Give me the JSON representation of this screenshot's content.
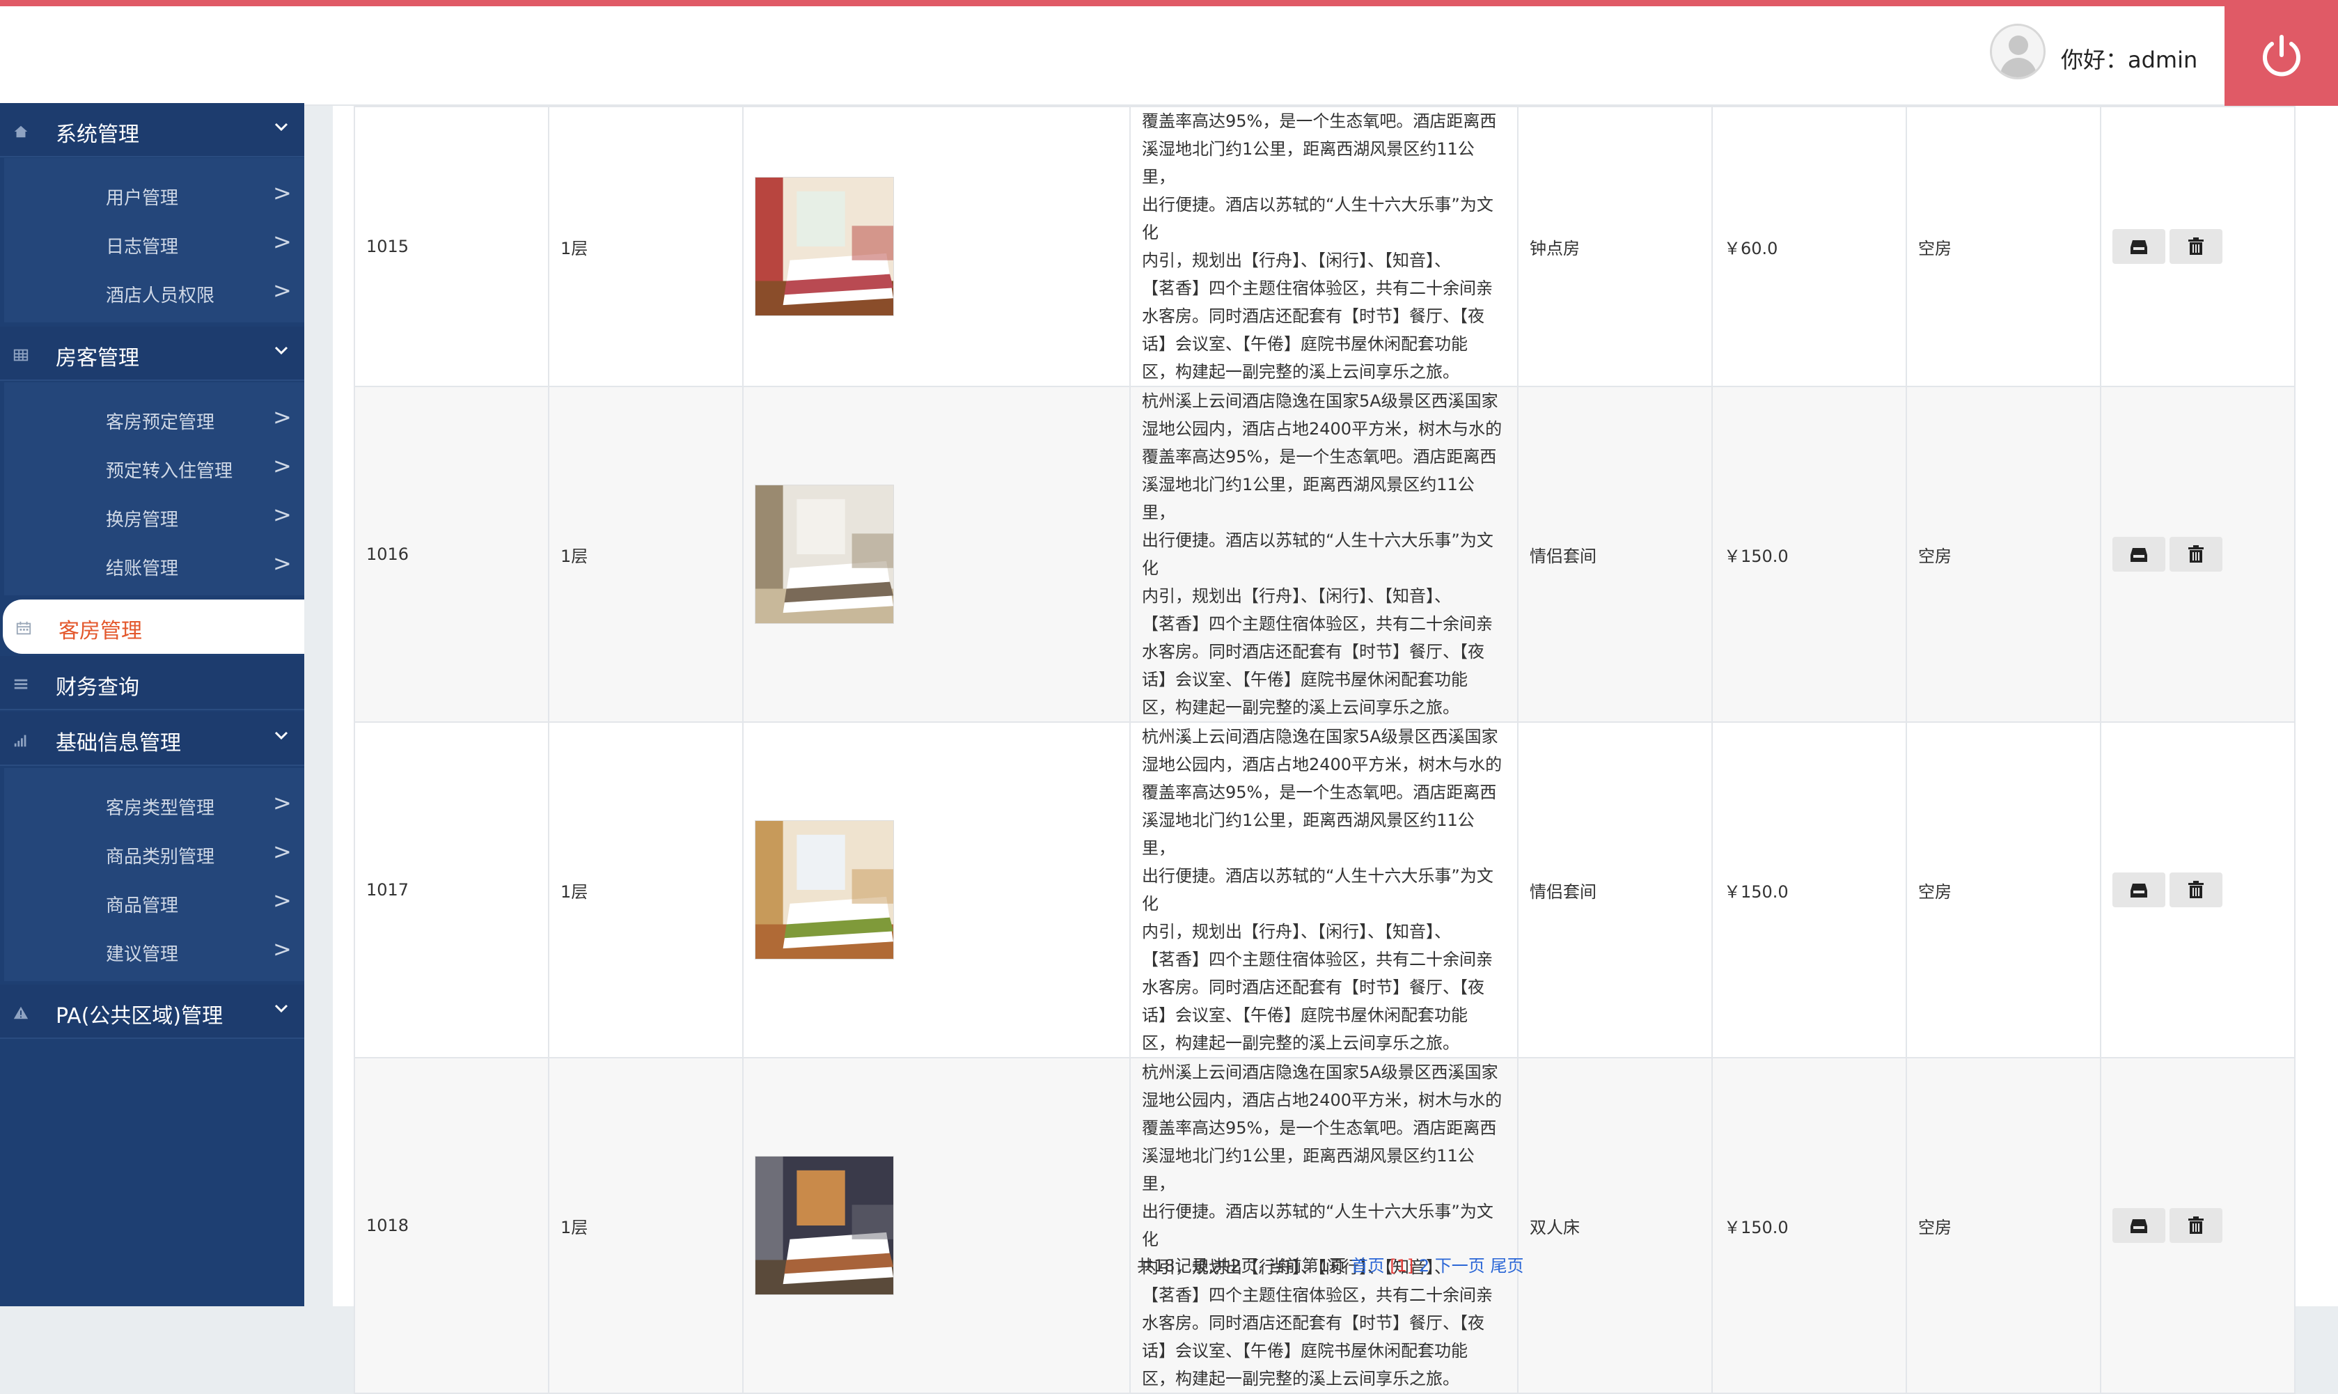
{
  "header": {
    "greeting": "你好：admin",
    "logout_icon": "power-icon"
  },
  "sidebar": {
    "groups": [
      {
        "label": "系统管理",
        "icon": "home-icon",
        "items": [
          "用户管理",
          "日志管理",
          "酒店人员权限"
        ]
      },
      {
        "label": "房客管理",
        "icon": "grid-icon",
        "items": [
          "客房预定管理",
          "预定转入住管理",
          "换房管理",
          "结账管理"
        ]
      },
      {
        "label": "客房管理",
        "icon": "calendar-icon",
        "active": true
      },
      {
        "label": "财务查询",
        "icon": "list-icon"
      },
      {
        "label": "基础信息管理",
        "icon": "signal-icon",
        "items": [
          "客房类型管理",
          "商品类别管理",
          "商品管理",
          "建议管理"
        ]
      },
      {
        "label": "PA(公共区域)管理",
        "icon": "warning-icon"
      }
    ],
    "arrow": ">"
  },
  "rooms": [
    {
      "no": "1015",
      "floor": "1层",
      "type": "钟点房",
      "price": "￥60.0",
      "status": "空房",
      "desc": [
        "覆盖率高达95%，是一个生态氧吧。酒店距离西",
        "溪湿地北门约1公里，距离西湖风景区约11公里，",
        "出行便捷。酒店以苏轼的“人生十六大乐事”为文化",
        "内引，规划出【行舟】、【闲行】、【知音】、",
        "【茗香】四个主题住宿体验区，共有二十余间亲",
        "水客房。同时酒店还配套有【时节】餐厅、【夜",
        "话】会议室、【午倦】庭院书屋休闲配套功能",
        "区，构建起一副完整的溪上云间享乐之旅。"
      ]
    },
    {
      "no": "1016",
      "floor": "1层",
      "type": "情侣套间",
      "price": "￥150.0",
      "status": "空房",
      "desc": [
        "杭州溪上云间酒店隐逸在国家5A级景区西溪国家",
        "湿地公园内，酒店占地2400平方米，树木与水的",
        "覆盖率高达95%，是一个生态氧吧。酒店距离西",
        "溪湿地北门约1公里，距离西湖风景区约11公里，",
        "出行便捷。酒店以苏轼的“人生十六大乐事”为文化",
        "内引，规划出【行舟】、【闲行】、【知音】、",
        "【茗香】四个主题住宿体验区，共有二十余间亲",
        "水客房。同时酒店还配套有【时节】餐厅、【夜",
        "话】会议室、【午倦】庭院书屋休闲配套功能",
        "区，构建起一副完整的溪上云间享乐之旅。"
      ]
    },
    {
      "no": "1017",
      "floor": "1层",
      "type": "情侣套间",
      "price": "￥150.0",
      "status": "空房",
      "desc": [
        "杭州溪上云间酒店隐逸在国家5A级景区西溪国家",
        "湿地公园内，酒店占地2400平方米，树木与水的",
        "覆盖率高达95%，是一个生态氧吧。酒店距离西",
        "溪湿地北门约1公里，距离西湖风景区约11公里，",
        "出行便捷。酒店以苏轼的“人生十六大乐事”为文化",
        "内引，规划出【行舟】、【闲行】、【知音】、",
        "【茗香】四个主题住宿体验区，共有二十余间亲",
        "水客房。同时酒店还配套有【时节】餐厅、【夜",
        "话】会议室、【午倦】庭院书屋休闲配套功能",
        "区，构建起一副完整的溪上云间享乐之旅。"
      ]
    },
    {
      "no": "1018",
      "floor": "1层",
      "type": "双人床",
      "price": "￥150.0",
      "status": "空房",
      "desc": [
        "杭州溪上云间酒店隐逸在国家5A级景区西溪国家",
        "湿地公园内，酒店占地2400平方米，树木与水的",
        "覆盖率高达95%，是一个生态氧吧。酒店距离西",
        "溪湿地北门约1公里，距离西湖风景区约11公里，",
        "出行便捷。酒店以苏轼的“人生十六大乐事”为文化",
        "内引，规划出【行舟】、【闲行】、【知音】、",
        "【茗香】四个主题住宿体验区，共有二十余间亲",
        "水客房。同时酒店还配套有【时节】餐厅、【夜",
        "话】会议室、【午倦】庭院书屋休闲配套功能",
        "区，构建起一副完整的溪上云间享乐之旅。"
      ]
    }
  ],
  "pager": {
    "summary": "共18记录,共2页, 当前第1页",
    "first": "首页",
    "current": "[1]",
    "page2": "2",
    "next": "下一页",
    "last": "尾页"
  },
  "colors": {
    "accent": "#e05a66",
    "sidebar": "#1e3f72",
    "active_text": "#e3572b",
    "link": "#2a66d6"
  }
}
